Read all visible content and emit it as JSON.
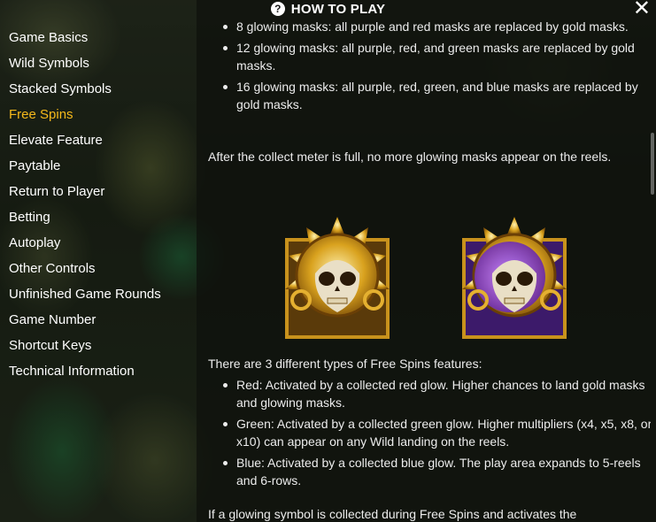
{
  "header": {
    "title": "HOW TO PLAY",
    "help_glyph": "?",
    "close_glyph": "✕"
  },
  "nav": {
    "items": [
      {
        "label": "Game Basics"
      },
      {
        "label": "Wild Symbols"
      },
      {
        "label": "Stacked Symbols"
      },
      {
        "label": "Free Spins"
      },
      {
        "label": "Elevate Feature"
      },
      {
        "label": "Paytable"
      },
      {
        "label": "Return to Player"
      },
      {
        "label": "Betting"
      },
      {
        "label": "Autoplay"
      },
      {
        "label": "Other Controls"
      },
      {
        "label": "Unfinished Game Rounds"
      },
      {
        "label": "Game Number"
      },
      {
        "label": "Shortcut Keys"
      },
      {
        "label": "Technical Information"
      }
    ],
    "active_index": 3
  },
  "content": {
    "mask_bullets": [
      "8 glowing masks: all purple and red masks are replaced by gold masks.",
      "12 glowing masks: all purple, red, and green masks are replaced by gold masks.",
      "16 glowing masks: all purple, red, green, and blue masks are replaced by gold masks."
    ],
    "meter_paragraph": "After the collect meter is full, no more glowing masks appear on the reels.",
    "symbols": [
      {
        "name": "gold-mask-symbol-icon"
      },
      {
        "name": "purple-glowing-mask-symbol-icon"
      }
    ],
    "types_intro": "There are 3 different types of Free Spins features:",
    "type_bullets": [
      "Red: Activated by a collected red glow. Higher chances to land gold masks and glowing masks.",
      "Green: Activated by a collected green glow. Higher multipliers (x4, x5, x8, or x10) can appear on any Wild landing on the reels.",
      "Blue: Activated by a collected blue glow. The play area expands to 5-reels and 6-rows."
    ],
    "trailing_paragraph": "If a glowing symbol is collected during Free Spins and activates the"
  },
  "colors": {
    "accent": "#f4b81b",
    "panel": "#0e100c",
    "text": "#ececec"
  }
}
